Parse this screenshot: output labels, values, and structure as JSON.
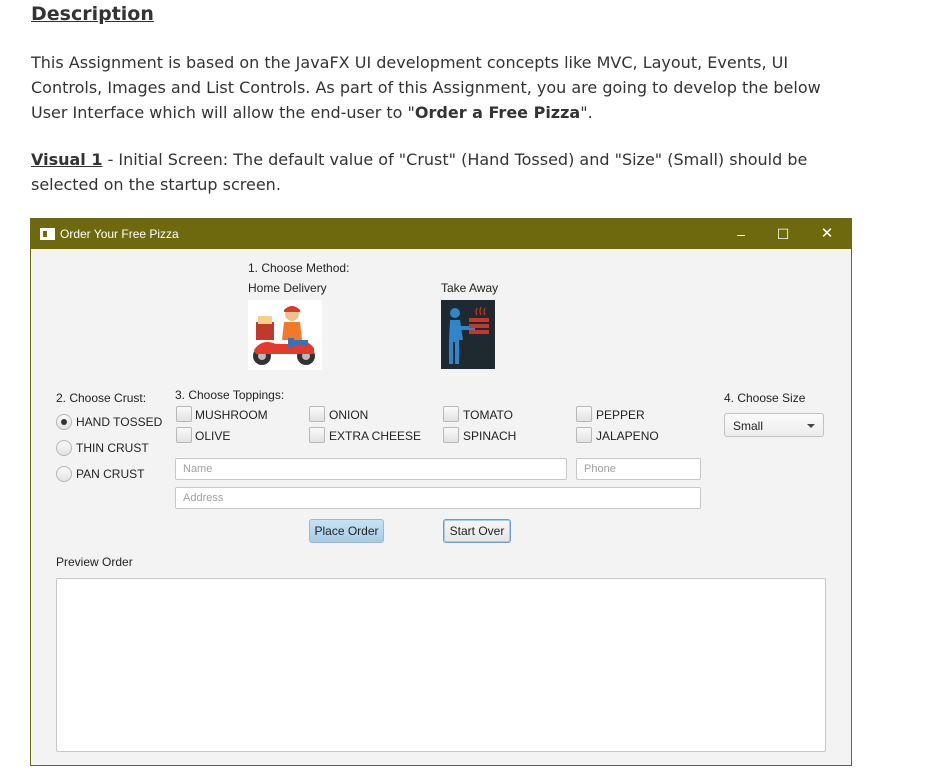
{
  "doc": {
    "heading": "Description",
    "intro_before": "This Assignment is based on the JavaFX UI development concepts like MVC, Layout, Events, UI Controls, Images and List Controls. As part of this Assignment, you are going to develop the below User Interface which will allow the end-user to \"",
    "intro_bold": "Order a Free Pizza",
    "intro_after": "\".",
    "visual_label": "Visual 1",
    "visual_text": " - Initial Screen: The default value of \"Crust\" (Hand Tossed) and \"Size\" (Small) should be selected on the startup screen."
  },
  "window": {
    "title": "Order Your Free Pizza",
    "controls": {
      "minimize": "–",
      "maximize": "☐",
      "close": "✕"
    }
  },
  "method": {
    "label": "1. Choose Method:",
    "home_delivery": "Home Delivery",
    "take_away": "Take Away"
  },
  "crust": {
    "label": "2. Choose Crust:",
    "options": [
      "HAND TOSSED",
      "THIN CRUST",
      "PAN CRUST"
    ],
    "selected": "HAND TOSSED"
  },
  "toppings": {
    "label": "3. Choose Toppings:",
    "items": [
      "MUSHROOM",
      "ONION",
      "TOMATO",
      "PEPPER",
      "OLIVE",
      "EXTRA CHEESE",
      "SPINACH",
      "JALAPENO"
    ]
  },
  "size": {
    "label": "4. Choose Size",
    "selected": "Small"
  },
  "form": {
    "name_placeholder": "Name",
    "phone_placeholder": "Phone",
    "address_placeholder": "Address"
  },
  "buttons": {
    "place_order": "Place Order",
    "start_over": "Start Over"
  },
  "preview": {
    "label": "Preview Order"
  },
  "colors": {
    "titlebar": "#6e690e",
    "accent_button": "#a6cbe6"
  }
}
